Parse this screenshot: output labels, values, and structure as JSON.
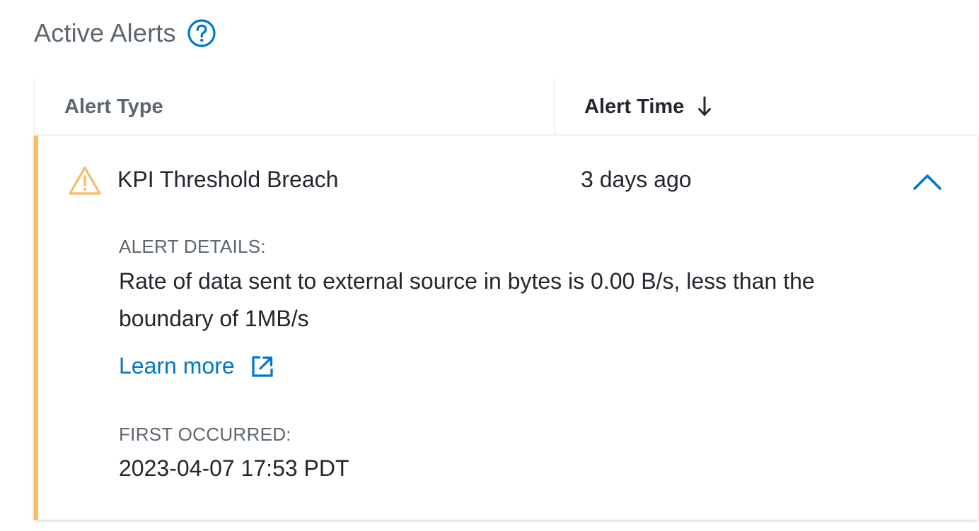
{
  "header": {
    "title": "Active Alerts",
    "help_icon": "help-circle-icon"
  },
  "table": {
    "columns": [
      {
        "label": "Alert Type",
        "sorted": false
      },
      {
        "label": "Alert Time",
        "sorted": true,
        "sort_direction": "descending",
        "sort_icon": "arrow-down-icon"
      }
    ],
    "rows": [
      {
        "severity_icon": "warning-triangle-icon",
        "severity_color": "#f7bd65",
        "alert_type": "KPI Threshold Breach",
        "alert_time": "3 days ago",
        "expanded": true,
        "toggle_icon": "chevron-up-icon",
        "details_label": "ALERT DETAILS:",
        "details_text": "Rate of data sent to external source in bytes is 0.00 B/s, less than the boundary of 1MB/s",
        "learn_more_label": "Learn more",
        "learn_more_icon": "external-link-icon",
        "first_occurred_label": "FIRST OCCURRED:",
        "first_occurred_value": "2023-04-07 17:53 PDT"
      }
    ]
  },
  "colors": {
    "accent": "#0076ce",
    "warning": "#f7bd65",
    "muted_text": "#5b6670",
    "text": "#22272e"
  }
}
